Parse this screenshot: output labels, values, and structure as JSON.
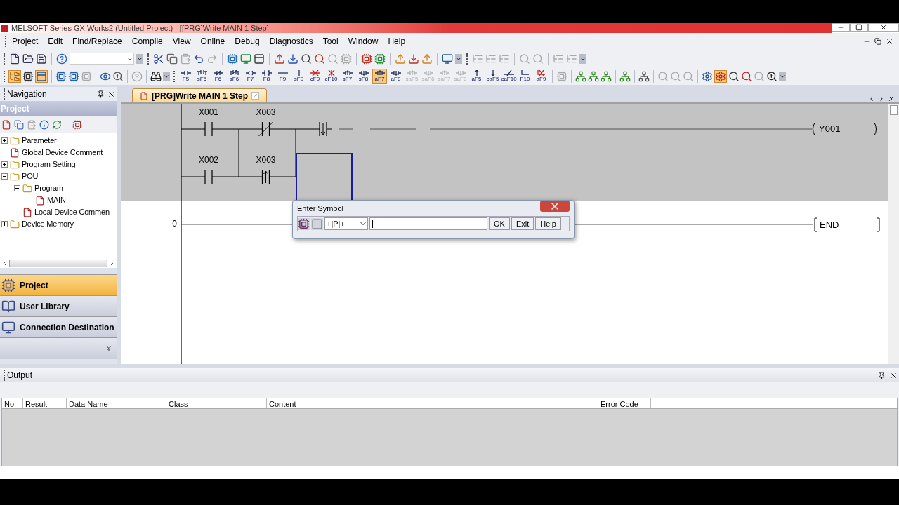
{
  "window": {
    "title": "MELSOFT Series GX Works2 (Untitled Project) - [[PRG]Write MAIN 1 Step]"
  },
  "menu": [
    "Project",
    "Edit",
    "Find/Replace",
    "Compile",
    "View",
    "Online",
    "Debug",
    "Diagnostics",
    "Tool",
    "Window",
    "Help"
  ],
  "ladder_keys": [
    {
      "label": "F5",
      "kind": "no",
      "selected": false,
      "disabled": false
    },
    {
      "label": "sF5",
      "kind": "no_par",
      "selected": false,
      "disabled": false
    },
    {
      "label": "F6",
      "kind": "nc",
      "selected": false,
      "disabled": false
    },
    {
      "label": "sF6",
      "kind": "nc_par",
      "selected": false,
      "disabled": false
    },
    {
      "label": "F7",
      "kind": "coil",
      "selected": false,
      "disabled": false
    },
    {
      "label": "F8",
      "kind": "inst",
      "selected": false,
      "disabled": false
    },
    {
      "label": "F9",
      "kind": "hline",
      "selected": false,
      "disabled": false
    },
    {
      "label": "sF9",
      "kind": "vline",
      "selected": false,
      "disabled": false
    },
    {
      "label": "cF9",
      "kind": "del_h",
      "selected": false,
      "disabled": false
    },
    {
      "label": "cF10",
      "kind": "del_v",
      "selected": false,
      "disabled": false
    },
    {
      "label": "sF7",
      "kind": "up",
      "selected": false,
      "disabled": false
    },
    {
      "label": "sF8",
      "kind": "down",
      "selected": false,
      "disabled": false
    },
    {
      "label": "aF7",
      "kind": "up_par",
      "selected": true,
      "disabled": false
    },
    {
      "label": "aF8",
      "kind": "down_par",
      "selected": false,
      "disabled": false
    },
    {
      "label": "saF5",
      "kind": "up",
      "selected": false,
      "disabled": true
    },
    {
      "label": "saF6",
      "kind": "down",
      "selected": false,
      "disabled": true
    },
    {
      "label": "saF7",
      "kind": "up_par",
      "selected": false,
      "disabled": true
    },
    {
      "label": "saF8",
      "kind": "down_par",
      "selected": false,
      "disabled": true
    },
    {
      "label": "aF5",
      "kind": "arrow_up",
      "selected": false,
      "disabled": false
    },
    {
      "label": "caF5",
      "kind": "arrow_down",
      "selected": false,
      "disabled": false
    },
    {
      "label": "caF10",
      "kind": "slash",
      "selected": false,
      "disabled": false
    },
    {
      "label": "F10",
      "kind": "corner",
      "selected": false,
      "disabled": false
    },
    {
      "label": "aF9",
      "kind": "del_corner",
      "selected": false,
      "disabled": false
    }
  ],
  "navigation": {
    "title": "Navigation",
    "section": "Project",
    "tree": [
      {
        "label": "Parameter",
        "kind": "group",
        "expanded": false
      },
      {
        "label": "Global Device Comment",
        "kind": "leaf"
      },
      {
        "label": "Program Setting",
        "kind": "group",
        "expanded": false
      },
      {
        "label": "POU",
        "kind": "group",
        "expanded": true,
        "children": [
          {
            "label": "Program",
            "kind": "group",
            "expanded": true,
            "children": [
              {
                "label": "MAIN",
                "kind": "leaf"
              }
            ]
          },
          {
            "label": "Local Device Commen",
            "kind": "leaf"
          }
        ]
      },
      {
        "label": "Device Memory",
        "kind": "group",
        "expanded": false
      }
    ],
    "tabs": [
      {
        "label": "Project",
        "selected": true
      },
      {
        "label": "User Library",
        "selected": false
      },
      {
        "label": "Connection Destination",
        "selected": false
      }
    ]
  },
  "editor": {
    "tab": {
      "label": "[PRG]Write MAIN 1 Step",
      "selected": true
    },
    "rows": [
      {
        "contacts": [
          {
            "label": "X001",
            "kind": "no"
          },
          {
            "label": "X003",
            "kind": "nc"
          },
          {
            "kind": "pulse_down"
          }
        ]
      },
      {
        "contacts": [
          {
            "label": "X002",
            "kind": "no"
          },
          {
            "label": "X003",
            "kind": "pulse_up"
          }
        ]
      }
    ],
    "coil": "Y001",
    "end_step": "0",
    "end": "END"
  },
  "dialog": {
    "title": "Enter Symbol",
    "symbol": "+|P|+",
    "buttons": [
      "OK",
      "Exit",
      "Help"
    ]
  },
  "output": {
    "title": "Output",
    "columns": [
      "No.",
      "Result",
      "Data Name",
      "Class",
      "Content",
      "Error Code"
    ]
  }
}
